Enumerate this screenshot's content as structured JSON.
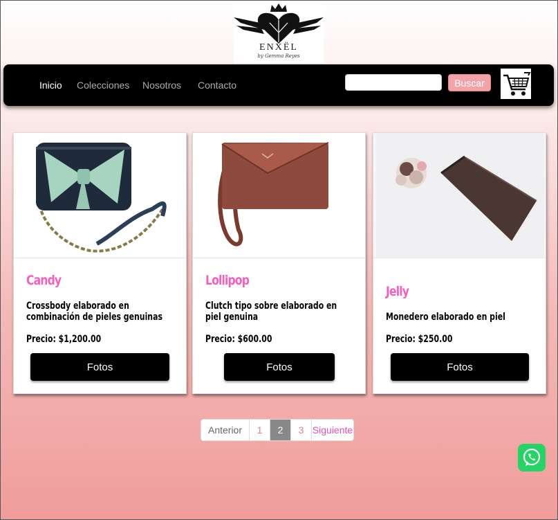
{
  "brand": {
    "name": "ENXËL",
    "byline": "by Gemma Reyes"
  },
  "nav": {
    "items": [
      {
        "label": "Inicio",
        "active": true
      },
      {
        "label": "Colecciones",
        "active": false
      },
      {
        "label": "Nosotros",
        "active": false
      },
      {
        "label": "Contacto",
        "active": false
      }
    ],
    "search": {
      "placeholder": "",
      "value": "",
      "button_label": "Buscar"
    },
    "cart_icon": "shopping-cart-icon"
  },
  "products": [
    {
      "name": "Candy",
      "description": "Crossbody elaborado en combinación de pieles genuinas",
      "price": "Precio: $1,200.00",
      "button_label": "Fotos",
      "image": "navy-crossbody-with-mint-bow"
    },
    {
      "name": "Lollipop",
      "description": "Clutch tipo sobre elaborado en piel genuina",
      "price": "Precio: $600.00",
      "button_label": "Fotos",
      "image": "brown-envelope-clutch"
    },
    {
      "name": "Jelly",
      "description": "Monedero elaborado en piel",
      "price": "Precio: $250.00",
      "button_label": "Fotos",
      "image": "dark-brown-leather-pouch"
    }
  ],
  "pagination": {
    "prev": "Anterior",
    "pages": [
      "1",
      "2",
      "3"
    ],
    "current": "2",
    "next": "Siguiente"
  },
  "colors": {
    "accent_pink": "#f65fc0",
    "button_black": "#000000",
    "search_button": "#f2a3a7",
    "whatsapp": "#25d366"
  }
}
